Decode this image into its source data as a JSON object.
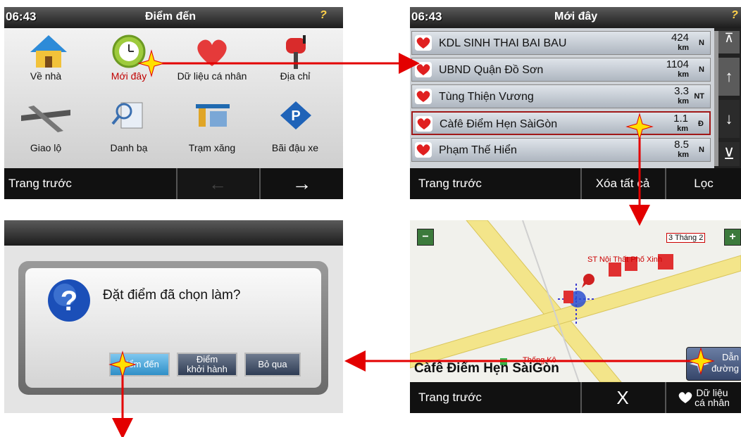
{
  "panel1": {
    "time": "06:43",
    "title": "Điểm đến",
    "help": "?",
    "icons": [
      {
        "label": "Về nhà",
        "icon": "home-icon"
      },
      {
        "label": "Mới đây",
        "icon": "recent-clock-icon",
        "active": true
      },
      {
        "label": "Dữ liệu cá nhân",
        "icon": "heart-icon"
      },
      {
        "label": "Địa chỉ",
        "icon": "mailbox-icon"
      },
      {
        "label": "Giao lộ",
        "icon": "intersection-icon"
      },
      {
        "label": "Danh bạ",
        "icon": "directory-icon"
      },
      {
        "label": "Trạm xăng",
        "icon": "gas-station-icon"
      },
      {
        "label": "Bãi đậu xe",
        "icon": "parking-icon"
      }
    ],
    "back": "Trang trước"
  },
  "panel2": {
    "time": "06:43",
    "title": "Mới đây",
    "rows": [
      {
        "name": "KDL SINH THAI BAI BAU",
        "dist": "424",
        "unit": "km",
        "dir": "N"
      },
      {
        "name": "UBND Quận Đồ Sơn",
        "dist": "1104",
        "unit": "km",
        "dir": "N"
      },
      {
        "name": "Tùng Thiện Vương",
        "dist": "3.3",
        "unit": "km",
        "dir": "NT"
      },
      {
        "name": "Càfê Điểm Hẹn SàiGòn",
        "dist": "1.1",
        "unit": "km",
        "dir": "Đ"
      },
      {
        "name": "Phạm Thế Hiển",
        "dist": "8.5",
        "unit": "km",
        "dir": "N"
      }
    ],
    "back": "Trang trước",
    "clear": "Xóa tất cả",
    "filter": "Lọc"
  },
  "panel3": {
    "question": "Đặt điểm đã chọn làm?",
    "b1": "Điểm đến",
    "b2a": "Điểm",
    "b2b": "khởi hành",
    "b3": "Bỏ qua"
  },
  "panel4": {
    "street": "3 Tháng 2",
    "poi": "ST Nội Thất Phố Xinh",
    "poi2": "Thống Kê",
    "place": "Càfê Điểm Hẹn SàiGòn",
    "route_a": "Dẫn",
    "route_b": "đường",
    "back": "Trang trước",
    "close": "X",
    "fav_a": "Dữ liệu",
    "fav_b": "cá nhân",
    "zoom_out": "−",
    "zoom_in": "+"
  },
  "colors": {
    "accent": "#e30000",
    "topbar": "#2a2a2a"
  }
}
